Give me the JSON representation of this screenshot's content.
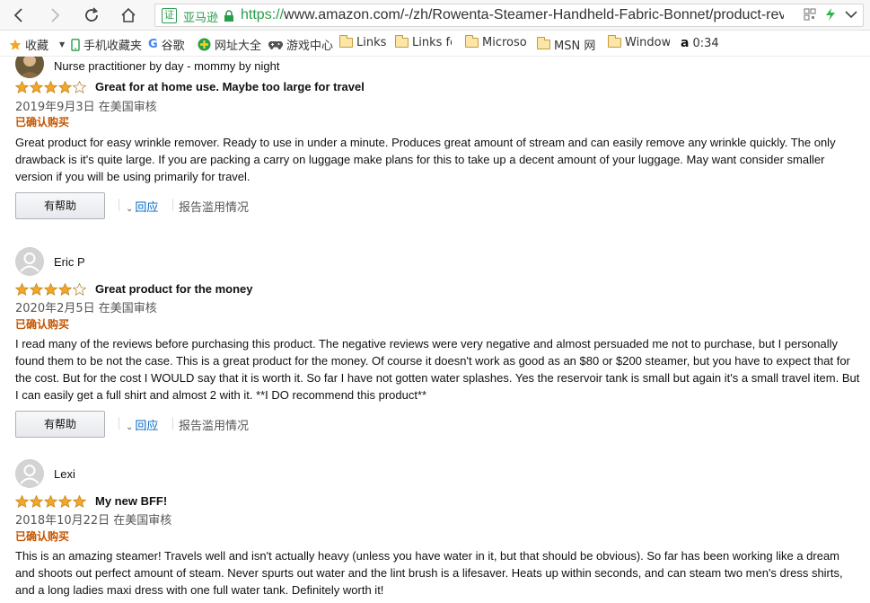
{
  "browser": {
    "cert_label": "亚马逊",
    "cert_icon": "证",
    "url_protocol": "https://",
    "url_rest": "www.amazon.com/-/zh/Rowenta-Steamer-Handheld-Fabric-Bonnet/product-revie"
  },
  "bookmarks": [
    {
      "icon": "star-icon",
      "label": "收藏"
    },
    {
      "icon": "phone-icon",
      "label": "手机收藏夹"
    },
    {
      "icon": "google-icon",
      "label": "谷歌"
    },
    {
      "icon": "plus-icon",
      "label": "网址大全"
    },
    {
      "icon": "gamepad-icon",
      "label": "游戏中心"
    },
    {
      "icon": "folder-icon",
      "label": "Links"
    },
    {
      "icon": "folder-icon",
      "label": "Links fo"
    },
    {
      "icon": "folder-icon",
      "label": "Microso"
    },
    {
      "icon": "folder-icon",
      "label": "MSN 网"
    },
    {
      "icon": "folder-icon",
      "label": "Window"
    },
    {
      "icon": "amazon-icon",
      "label": "0:34"
    }
  ],
  "reviews": [
    {
      "name": "Nurse practitioner by day - mommy by night",
      "rating": 4,
      "title": "Great for at home use. Maybe too large for travel",
      "date": "2019年9月3日 在美国审核",
      "verified": "已确认购买",
      "body": "Great product for easy wrinkle remover. Ready to use in under a minute. Produces great amount of stream and can easily remove any wrinkle quickly. The only drawback is it's quite large. If you are packing a carry on luggage make plans for this to take up a decent amount of your luggage. May want consider smaller version if you will be using primarily for travel.",
      "helpful_label": "有帮助",
      "reply_label": "回应",
      "report_label": "报告滥用情况"
    },
    {
      "name": "Eric P",
      "rating": 4,
      "title": "Great product for the money",
      "date": "2020年2月5日 在美国审核",
      "verified": "已确认购买",
      "body": "I read many of the reviews before purchasing this product. The negative reviews were very negative and almost persuaded me not to purchase, but I personally found them to be not the case. This is a great product for the money. Of course it doesn't work as good as an $80 or $200 steamer, but you have to expect that for the cost. But for the cost I WOULD say that it is worth it. So far I have not gotten water splashes. Yes the reservoir tank is small but again it's a small travel item. But I can easily get a full shirt and almost 2 with it. **I DO recommend this product**",
      "helpful_label": "有帮助",
      "reply_label": "回应",
      "report_label": "报告滥用情况"
    },
    {
      "name": "Lexi",
      "rating": 5,
      "title": "My new BFF!",
      "date": "2018年10月22日 在美国审核",
      "verified": "已确认购买",
      "body": "This is an amazing steamer! Travels well and isn't actually heavy (unless you have water in it, but that should be obvious). So far has been working like a dream and shoots out perfect amount of steam. Never spurts out water and the lint brush is a lifesaver. Heats up within seconds, and can steam two men's dress shirts, and a long ladies maxi dress with one full water tank. Definitely worth it!"
    }
  ],
  "colors": {
    "star": "#f0a72a",
    "link": "#0066c0",
    "verified": "#c45500",
    "secure": "#2a9d4b"
  }
}
